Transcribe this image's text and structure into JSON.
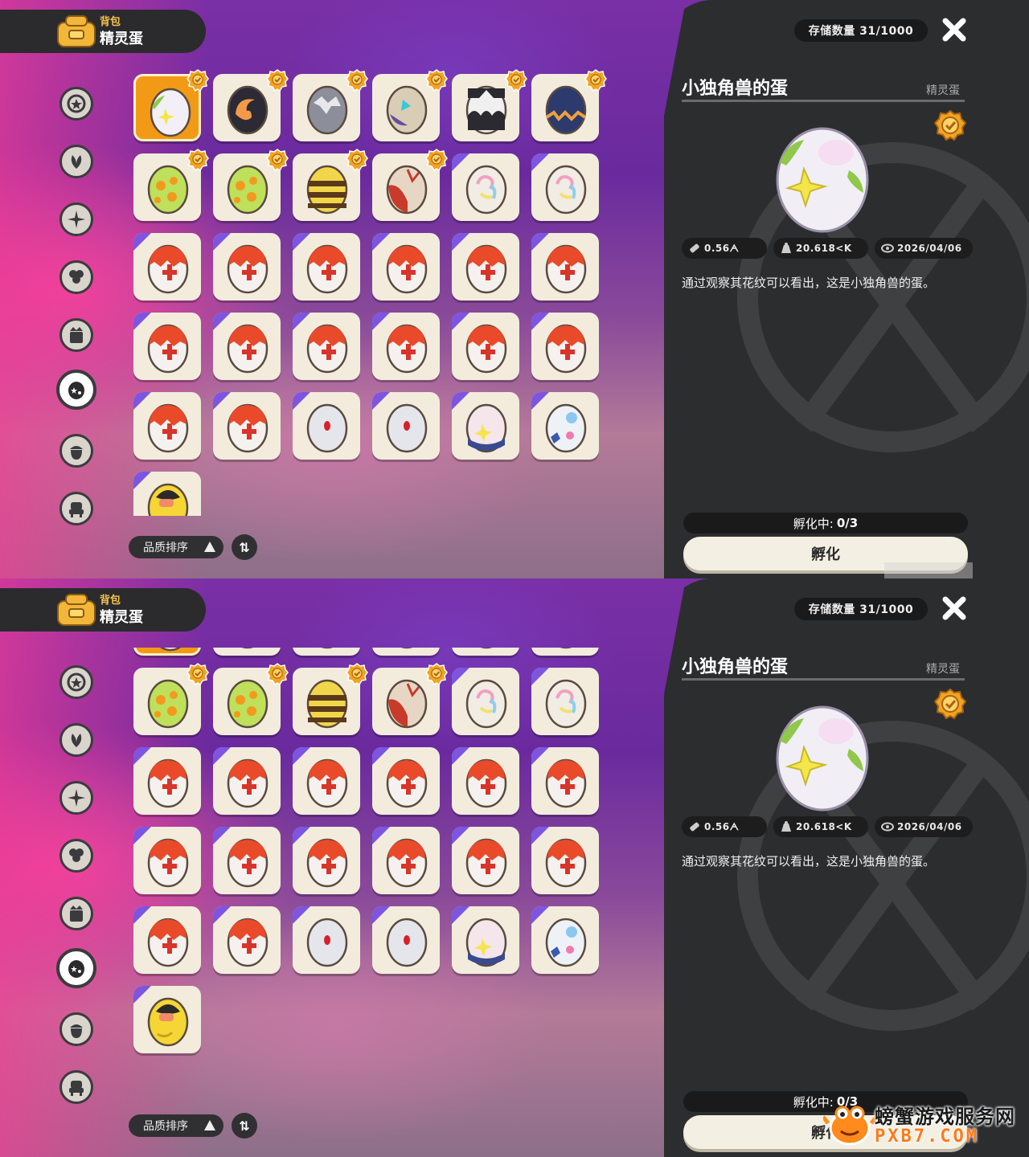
{
  "header": {
    "sub": "背包",
    "title": "精灵蛋"
  },
  "storage": "存储数量 31/1000",
  "detail": {
    "name": "小独角兽的蛋",
    "category": "精灵蛋",
    "size": "0.56ᗅ",
    "weight": "20.618<K",
    "date": "2026/04/06",
    "description": "通过观察其花纹可以看出，这是小独角兽的蛋。"
  },
  "sort": {
    "label": "品质排序"
  },
  "hatch": {
    "status_label": "孵化中:",
    "status_value": "0/3",
    "button": "孵化"
  },
  "watermark": {
    "line1": "螃蟹游戏服务网",
    "line2": "PXB7.COM"
  },
  "colors": {
    "accent": "#f29a16",
    "panel": "#2c2d2f",
    "cell": "#f3ecdd",
    "corner": "#7d55e0"
  },
  "sidebar_icons": [
    "star-badge-icon",
    "leaf-icon",
    "sparkle-icon",
    "clover-icon",
    "crown-book-icon",
    "egg-category-icon",
    "acorn-icon",
    "chair-icon"
  ],
  "eggs": [
    {
      "type": "unicorn",
      "medal": true,
      "corner": false
    },
    {
      "type": "flame",
      "medal": true,
      "corner": false
    },
    {
      "type": "stone",
      "medal": true,
      "corner": false
    },
    {
      "type": "tan-cyan",
      "medal": true,
      "corner": false
    },
    {
      "type": "black-white",
      "medal": true,
      "corner": false
    },
    {
      "type": "navy",
      "medal": true,
      "corner": false
    },
    {
      "type": "green-spot",
      "medal": true,
      "corner": false
    },
    {
      "type": "green-spot",
      "medal": true,
      "corner": false
    },
    {
      "type": "striped",
      "medal": true,
      "corner": false
    },
    {
      "type": "red-tan",
      "medal": true,
      "corner": false
    },
    {
      "type": "rainbow",
      "medal": false,
      "corner": true
    },
    {
      "type": "rainbow",
      "medal": false,
      "corner": true
    },
    {
      "type": "cross",
      "medal": false,
      "corner": true
    },
    {
      "type": "cross",
      "medal": false,
      "corner": true
    },
    {
      "type": "cross",
      "medal": false,
      "corner": true
    },
    {
      "type": "cross",
      "medal": false,
      "corner": true
    },
    {
      "type": "cross",
      "medal": false,
      "corner": true
    },
    {
      "type": "cross",
      "medal": false,
      "corner": true
    },
    {
      "type": "cross",
      "medal": false,
      "corner": true
    },
    {
      "type": "cross",
      "medal": false,
      "corner": true
    },
    {
      "type": "cross",
      "medal": false,
      "corner": true
    },
    {
      "type": "cross",
      "medal": false,
      "corner": true
    },
    {
      "type": "cross",
      "medal": false,
      "corner": true
    },
    {
      "type": "cross",
      "medal": false,
      "corner": true
    },
    {
      "type": "cross",
      "medal": false,
      "corner": true
    },
    {
      "type": "cross",
      "medal": false,
      "corner": true
    },
    {
      "type": "white-red",
      "medal": false,
      "corner": true
    },
    {
      "type": "white-red",
      "medal": false,
      "corner": true
    },
    {
      "type": "pink-star",
      "medal": false,
      "corner": true
    },
    {
      "type": "blue-white",
      "medal": false,
      "corner": true
    },
    {
      "type": "yellow",
      "medal": false,
      "corner": true
    }
  ]
}
